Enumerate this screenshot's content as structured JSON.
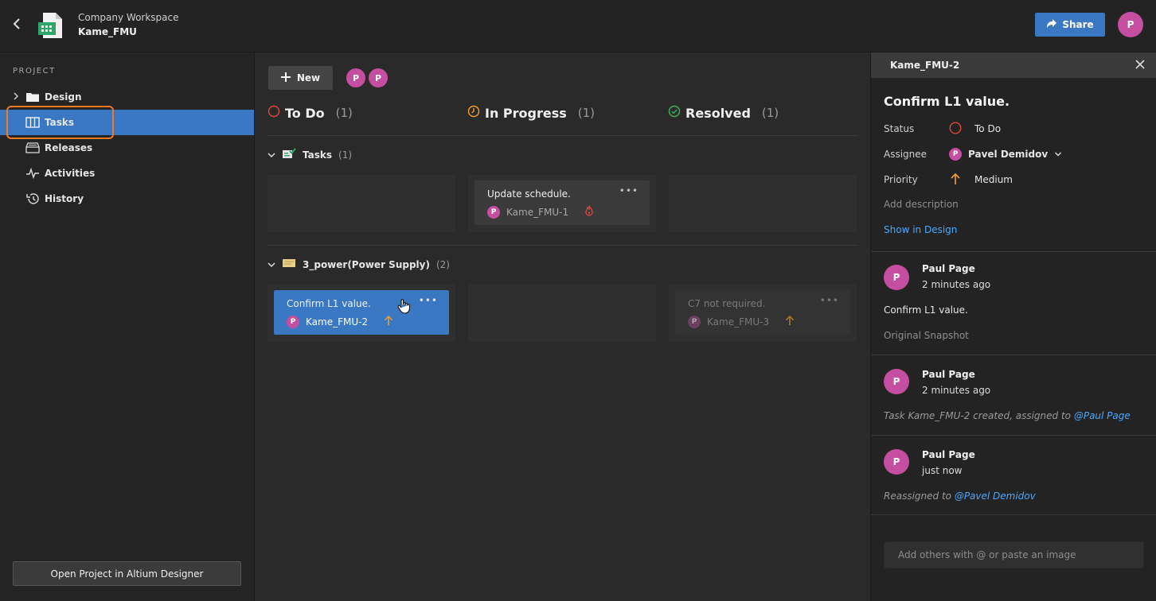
{
  "header": {
    "workspace": "Company Workspace",
    "project": "Kame_FMU",
    "share_label": "Share",
    "user_initial": "P"
  },
  "sidebar": {
    "section": "PROJECT",
    "items": [
      {
        "label": "Design",
        "icon": "folder-icon",
        "expandable": true
      },
      {
        "label": "Tasks",
        "icon": "board-icon",
        "active": true
      },
      {
        "label": "Releases",
        "icon": "releases-icon"
      },
      {
        "label": "Activities",
        "icon": "pulse-icon"
      },
      {
        "label": "History",
        "icon": "history-icon"
      }
    ],
    "open_button": "Open Project in Altium Designer"
  },
  "board": {
    "new_label": "New",
    "avatars": [
      "P",
      "P"
    ],
    "columns": [
      {
        "label": "To Do",
        "count": "(1)",
        "icon": "todo-circle-icon"
      },
      {
        "label": "In Progress",
        "count": "(1)",
        "icon": "clock-icon"
      },
      {
        "label": "Resolved",
        "count": "(1)",
        "icon": "check-circle-icon"
      }
    ],
    "groups": [
      {
        "name": "Tasks",
        "count": "(1)",
        "icon": "tasks-board-icon",
        "cards": [
          {
            "title": "Update schedule.",
            "id": "Kame_FMU-1",
            "priority_icon": "fire-icon",
            "column": 1
          }
        ]
      },
      {
        "name": "3_power(Power Supply)",
        "count": "(2)",
        "icon": "schematic-icon",
        "cards": [
          {
            "title": "Confirm L1 value.",
            "id": "Kame_FMU-2",
            "priority_icon": "arrow-up-icon",
            "column": 0,
            "selected": true
          },
          {
            "title": "C7 not required.",
            "id": "Kame_FMU-3",
            "priority_icon": "arrow-up-icon",
            "column": 2,
            "dim": true
          }
        ]
      }
    ],
    "card_initial": "P",
    "more": "•••"
  },
  "panel": {
    "id": "Kame_FMU-2",
    "title": "Confirm L1 value.",
    "status_key": "Status",
    "status_val": "To Do",
    "assignee_key": "Assignee",
    "assignee_val": "Pavel Demidov",
    "assignee_initial": "P",
    "priority_key": "Priority",
    "priority_val": "Medium",
    "add_description": "Add description",
    "show_in_design": "Show in Design",
    "comments": [
      {
        "author": "Paul Page",
        "time": "2 minutes ago",
        "body": "Confirm L1 value.",
        "sub": "Original Snapshot"
      },
      {
        "author": "Paul Page",
        "time": "2 minutes ago",
        "activity_prefix": "Task Kame_FMU-2 created, assigned to ",
        "mention": "@Paul Page"
      },
      {
        "author": "Paul Page",
        "time": "just now",
        "activity_prefix": "Reassigned to ",
        "mention": "@Pavel Demidov"
      }
    ],
    "comment_placeholder": "Add others with @ or paste an image"
  },
  "colors": {
    "accent": "#3a78c4",
    "avatar": "#c64ea0",
    "highlight": "#f07a24",
    "link": "#4aa8ff",
    "priority_medium": "#f0a030",
    "todo": "#e0463c",
    "resolved": "#3cb460"
  }
}
